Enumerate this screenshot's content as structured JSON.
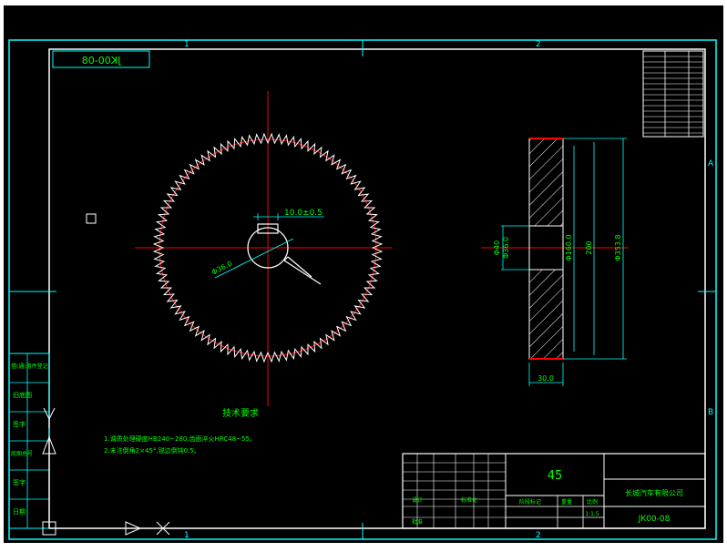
{
  "drawing": {
    "part_code_box": "JK00-08",
    "zone_top_left": "1",
    "zone_top_mid": "2",
    "zone_bottom_left": "1",
    "zone_bottom_mid": "2",
    "zone_right_a": "A",
    "zone_right_b": "B"
  },
  "gear_front_view": {
    "dim_keyway": "10.0±0.5",
    "dim_bore": "Φ36.0"
  },
  "gear_section_view": {
    "dim_hub": "Φ40",
    "dim_key": "Φ36.0",
    "dim_root": "Φ160.0",
    "dim_mid": "200",
    "dim_outer": "Φ353.8",
    "dim_width": "30.0"
  },
  "tech_notes": {
    "heading": "技术要求",
    "line1": "1.调质处理硬度HB240~280,齿面淬火HRC48~55。",
    "line2": "2.未注倒角2×45°,锐边倒钝0.5。"
  },
  "left_margin_labels": [
    "借(通)用件登记",
    "旧底图",
    "签字",
    "底图总号",
    "签字",
    "日期"
  ],
  "title_block": {
    "material": "45",
    "company": "长城汽车有限公司",
    "drawing_no": "JK00-08",
    "scale": "1:1.5",
    "row_designer": "设计",
    "row_check": "标准化",
    "row_approve": "批准",
    "col_stage": "阶段标记",
    "col_weight": "重量",
    "col_scale": "比例"
  },
  "colors": {
    "background": "#000000",
    "frame": "#00ffff",
    "text": "#00ff00",
    "center_line": "#ff0000",
    "white": "#ffffff"
  },
  "icons": [
    "ucs-axis-icon",
    "cursor-square-icon"
  ]
}
